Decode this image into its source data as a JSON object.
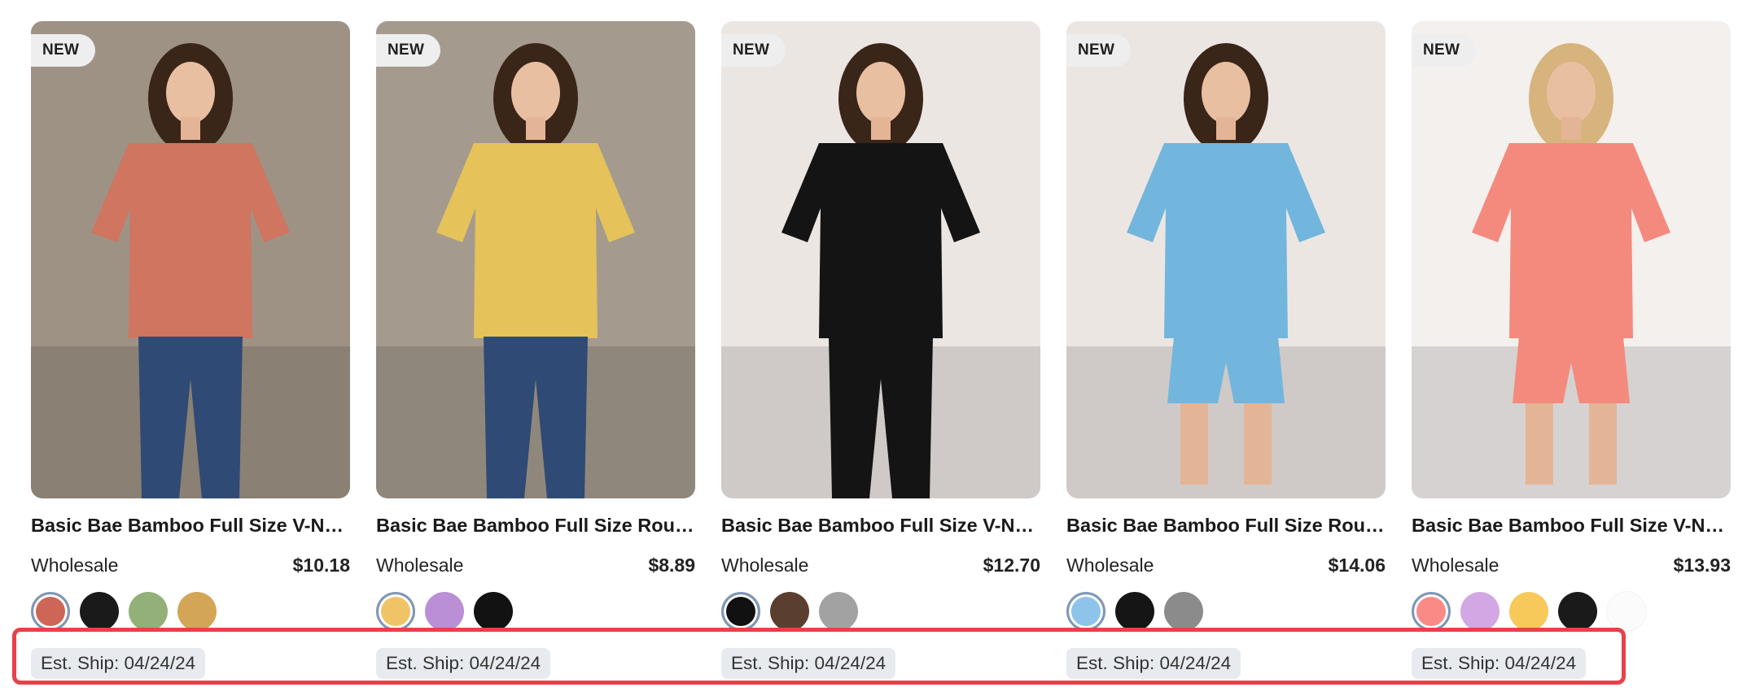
{
  "products": [
    {
      "badge": "NEW",
      "title": "Basic Bae Bamboo Full Size V-Neck Drop Shoulder T-Shirt",
      "price_label": "Wholesale",
      "price": "$10.18",
      "ship": "Est. Ship: 04/24/24",
      "image": {
        "bg": "#9e9285",
        "top": "#cf7560",
        "bottom": "#2f4a74",
        "sleeves": "long-hair"
      },
      "swatches": [
        {
          "color": "#cd6656",
          "selected": true
        },
        {
          "color": "#1a1a1a",
          "selected": false
        },
        {
          "color": "#92b077",
          "selected": false
        },
        {
          "color": "#d2a656",
          "selected": false
        }
      ]
    },
    {
      "badge": "NEW",
      "title": "Basic Bae Bamboo Full Size Round Neck Drop Shoulder T-Shirt",
      "price_label": "Wholesale",
      "price": "$8.89",
      "ship": "Est. Ship: 04/24/24",
      "image": {
        "bg": "#a49a8e",
        "top": "#e5c25a",
        "bottom": "#2f4a74"
      },
      "swatches": [
        {
          "color": "#f0c466",
          "selected": true
        },
        {
          "color": "#ba8fd6",
          "selected": false
        },
        {
          "color": "#121212",
          "selected": false
        }
      ]
    },
    {
      "badge": "NEW",
      "title": "Basic Bae Bamboo Full Size V-Neck Long Sleeve Top and Pants Set",
      "price_label": "Wholesale",
      "price": "$12.70",
      "ship": "Est. Ship: 04/24/24",
      "image": {
        "bg": "#ece6e3",
        "top": "#141414",
        "bottom": "#141414"
      },
      "swatches": [
        {
          "color": "#111111",
          "selected": true
        },
        {
          "color": "#5a3f31",
          "selected": false
        },
        {
          "color": "#a2a2a2",
          "selected": false
        }
      ]
    },
    {
      "badge": "NEW",
      "title": "Basic Bae Bamboo Full Size Round Neck T-Shirt and Shorts Set",
      "price_label": "Wholesale",
      "price": "$14.06",
      "ship": "Est. Ship: 04/24/24",
      "image": {
        "bg": "#ece6e3",
        "top": "#72b6dd",
        "bottom": "#72b6dd"
      },
      "swatches": [
        {
          "color": "#8ec4ea",
          "selected": true
        },
        {
          "color": "#151515",
          "selected": false
        },
        {
          "color": "#8b8b8b",
          "selected": false
        }
      ]
    },
    {
      "badge": "NEW",
      "title": "Basic Bae Bamboo Full Size V-Neck Drop Shoulder T-Shirt and Shorts Set",
      "price_label": "Wholesale",
      "price": "$13.93",
      "ship": "Est. Ship: 04/24/24",
      "image": {
        "bg": "#f3f0ee",
        "top": "#f48a7e",
        "bottom": "#f48a7e"
      },
      "swatches": [
        {
          "color": "#fa8a86",
          "selected": true
        },
        {
          "color": "#d3a7e3",
          "selected": false
        },
        {
          "color": "#f6c95a",
          "selected": false
        },
        {
          "color": "#1a1a1a",
          "selected": false
        },
        {
          "color": "#fbfbfb",
          "selected": false
        }
      ]
    }
  ],
  "highlight_color": "#e8414a"
}
